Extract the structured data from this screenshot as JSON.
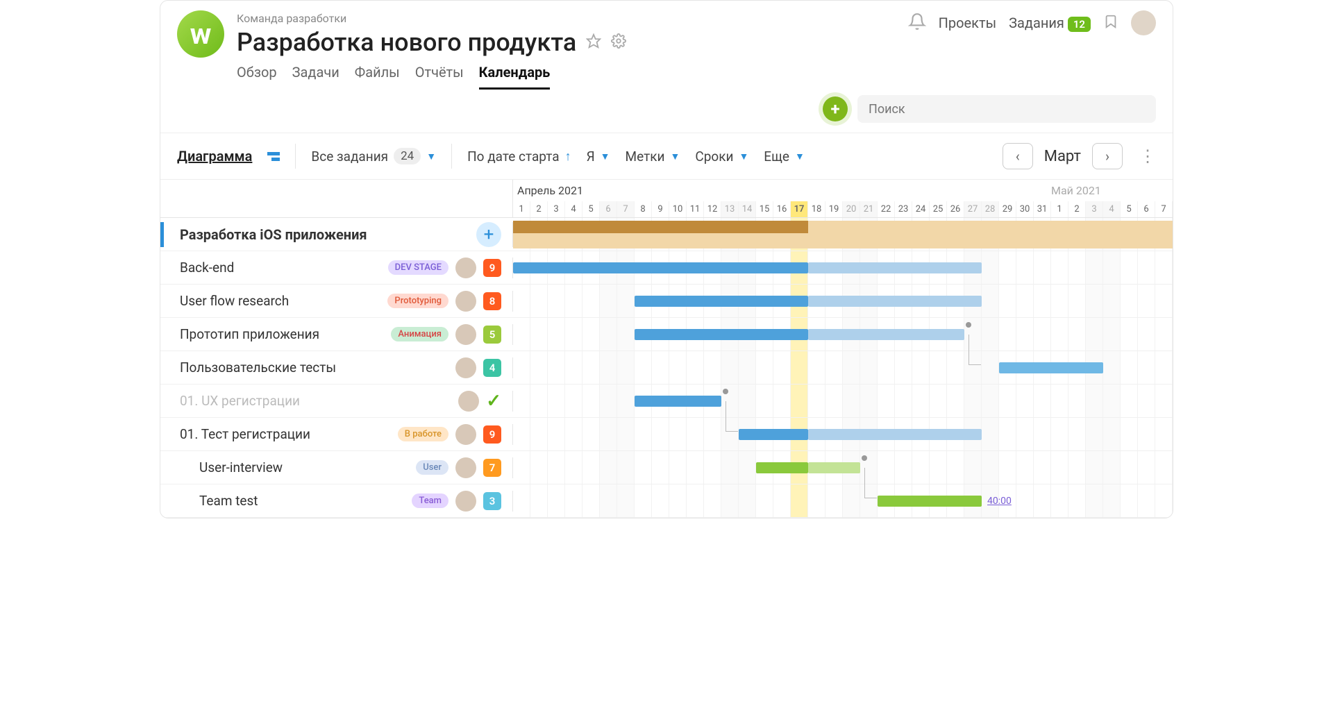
{
  "breadcrumb": "Команда разработки",
  "page_title": "Разработка нового продукта",
  "tabs": [
    "Обзор",
    "Задачи",
    "Файлы",
    "Отчёты",
    "Календарь"
  ],
  "active_tab": 4,
  "nav": {
    "projects": "Проекты",
    "tasks": "Задания",
    "task_count": "12"
  },
  "search_placeholder": "Поиск",
  "toolbar": {
    "diagram": "Диаграмма",
    "all_tasks": "Все задания",
    "all_count": "24",
    "by_start": "По дате старта",
    "me": "Я",
    "labels": "Метки",
    "dates": "Сроки",
    "more": "Еще",
    "month": "Март"
  },
  "timeline": {
    "month1": "Апрель 2021",
    "month2": "Май 2021",
    "days": [
      1,
      2,
      3,
      4,
      5,
      6,
      7,
      8,
      9,
      10,
      11,
      12,
      13,
      14,
      15,
      16,
      17,
      18,
      19,
      20,
      21,
      22,
      23,
      24,
      25,
      26,
      27,
      28,
      29,
      30,
      31,
      1,
      2,
      3,
      4,
      5,
      6,
      7
    ],
    "today_index": 16,
    "weekend_idx": [
      5,
      6,
      12,
      13,
      19,
      20,
      26,
      27,
      33,
      34
    ]
  },
  "group": {
    "name": "Разработка iOS приложения"
  },
  "tasks": [
    {
      "name": "Back-end",
      "tag": "DEV STAGE",
      "tag_bg": "#e4daff",
      "tag_fg": "#7a5ed6",
      "badge": "9",
      "badge_c": "#ff5a1f",
      "bar_start": 0,
      "bar_end": 27,
      "bar_fade": 17,
      "bar_c": "#4ea1db",
      "bar_light": "#aed0eb"
    },
    {
      "name": "User flow research",
      "tag": "Prototyping",
      "tag_bg": "#ffd9d0",
      "tag_fg": "#e05a3a",
      "badge": "8",
      "badge_c": "#ff5a1f",
      "bar_start": 7,
      "bar_end": 27,
      "bar_fade": 17,
      "bar_c": "#4ea1db",
      "bar_light": "#aed0eb"
    },
    {
      "name": "Прототип приложения",
      "tag": "Анимация",
      "tag_bg": "#c9edd4",
      "tag_fg": "#d64545",
      "badge": "5",
      "badge_c": "#9bca3c",
      "bar_start": 7,
      "bar_end": 26,
      "bar_fade": 17,
      "bar_c": "#4ea1db",
      "bar_light": "#aed0eb",
      "dep_to": 26
    },
    {
      "name": "Пользовательские тесты",
      "badge": "4",
      "badge_c": "#3cc4a4",
      "bar_start": 28,
      "bar_end": 34,
      "bar_c": "#6fb8e5",
      "dep_from": 26
    },
    {
      "name": "01. UX регистрации",
      "done": true,
      "bar_start": 7,
      "bar_end": 12,
      "bar_c": "#4ea1db",
      "dep_to": 12
    },
    {
      "name": "01. Тест регистрации",
      "tag": "В работе",
      "tag_bg": "#ffe6c7",
      "tag_fg": "#d8952a",
      "badge": "9",
      "badge_c": "#ff5a1f",
      "bar_start": 13,
      "bar_end": 27,
      "bar_fade": 17,
      "bar_c": "#4ea1db",
      "bar_light": "#aed0eb",
      "dep_from": 12
    },
    {
      "name": "User-interview",
      "indent": true,
      "tag": "User",
      "tag_bg": "#dce5f5",
      "tag_fg": "#6a88b8",
      "badge": "7",
      "badge_c": "#ff9a1f",
      "bar_start": 14,
      "bar_end": 20,
      "bar_fade": 17,
      "bar_c": "#8ac93c",
      "bar_light": "#c3e396",
      "dep_to": 20
    },
    {
      "name": "Team test",
      "indent": true,
      "tag": "Team",
      "tag_bg": "#e4d4ff",
      "tag_fg": "#8a5ed6",
      "badge": "3",
      "badge_c": "#5bc3e0",
      "bar_start": 21,
      "bar_end": 27,
      "bar_c": "#8ac93c",
      "time": "40:00",
      "dep_from": 20
    }
  ],
  "chart_data": {
    "type": "gantt",
    "x_axis": "date",
    "x_start": "2021-04-01",
    "x_end": "2021-05-07",
    "today": "2021-04-17",
    "group": {
      "name": "Разработка iOS приложения",
      "start": "2021-04-01",
      "progress_end": "2021-04-17",
      "end": "2021-05-07"
    },
    "tasks": [
      {
        "name": "Back-end",
        "start": "2021-04-01",
        "end": "2021-04-28",
        "progress_end": "2021-04-17"
      },
      {
        "name": "User flow research",
        "start": "2021-04-08",
        "end": "2021-04-28",
        "progress_end": "2021-04-17"
      },
      {
        "name": "Прототип приложения",
        "start": "2021-04-08",
        "end": "2021-04-27",
        "progress_end": "2021-04-17"
      },
      {
        "name": "Пользовательские тесты",
        "start": "2021-04-29",
        "end": "2021-05-04"
      },
      {
        "name": "01. UX регистрации",
        "start": "2021-04-08",
        "end": "2021-04-13",
        "done": true
      },
      {
        "name": "01. Тест регистрации",
        "start": "2021-04-14",
        "end": "2021-04-28",
        "progress_end": "2021-04-17"
      },
      {
        "name": "User-interview",
        "start": "2021-04-15",
        "end": "2021-04-21",
        "progress_end": "2021-04-17",
        "parent": "01. Тест регистрации"
      },
      {
        "name": "Team test",
        "start": "2021-04-22",
        "end": "2021-04-28",
        "hours": "40:00",
        "parent": "01. Тест регистрации"
      }
    ],
    "dependencies": [
      [
        "Прототип приложения",
        "Пользовательские тесты"
      ],
      [
        "01. UX регистрации",
        "01. Тест регистрации"
      ],
      [
        "User-interview",
        "Team test"
      ]
    ]
  }
}
